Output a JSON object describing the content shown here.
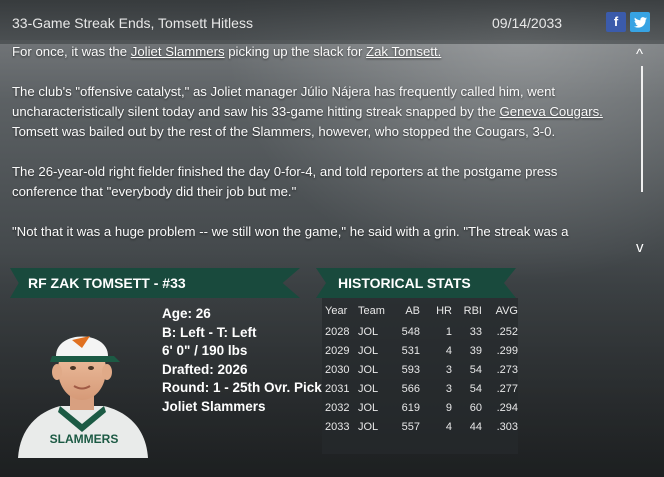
{
  "article": {
    "title": "33-Game Streak Ends, Tomsett Hitless",
    "date": "09/14/2033",
    "p1": {
      "pre": "For once, it was the ",
      "link1": "Joliet Slammers",
      "mid": " picking up the slack for ",
      "link2": "Zak Tomsett."
    },
    "p2": {
      "pre": "The club's \"offensive catalyst,\" as Joliet manager Júlio Nájera has frequently called him, went uncharacteristically silent today and saw his 33-game hitting streak snapped by the ",
      "link": "Geneva Cougars.",
      "post": " Tomsett was bailed out by the rest of the Slammers, however, who stopped the Cougars, 3-0."
    },
    "p3": "The 26-year-old right fielder finished the day 0-for-4, and told reporters at the postgame press conference that \"everybody did their job but me.\"",
    "p4": "\"Not that it was a huge problem -- we still won the game,\" he said with a grin. \"The streak was a"
  },
  "share": {
    "facebook_icon": "facebook-icon",
    "twitter_icon": "twitter-icon",
    "facebook_glyph": "f",
    "twitter_glyph": "🐦"
  },
  "scroll": {
    "up": "^",
    "down": "v"
  },
  "player": {
    "header": "RF ZAK TOMSETT - #33",
    "age": "Age: 26",
    "bats_throws": "B: Left - T: Left",
    "height_weight": "6' 0\" / 190 lbs",
    "drafted": "Drafted: 2026",
    "round": "Round: 1 - 25th Ovr. Pick",
    "team": "Joliet Slammers",
    "jersey_text": "SLAMMERS"
  },
  "stats": {
    "header": "HISTORICAL STATS",
    "columns": [
      "Year",
      "Team",
      "AB",
      "HR",
      "RBI",
      "AVG"
    ],
    "rows": [
      [
        "2028",
        "JOL",
        "548",
        "1",
        "33",
        ".252"
      ],
      [
        "2029",
        "JOL",
        "531",
        "4",
        "39",
        ".299"
      ],
      [
        "2030",
        "JOL",
        "593",
        "3",
        "54",
        ".273"
      ],
      [
        "2031",
        "JOL",
        "566",
        "3",
        "54",
        ".277"
      ],
      [
        "2032",
        "JOL",
        "619",
        "9",
        "60",
        ".294"
      ],
      [
        "2033",
        "JOL",
        "557",
        "4",
        "44",
        ".303"
      ]
    ]
  }
}
